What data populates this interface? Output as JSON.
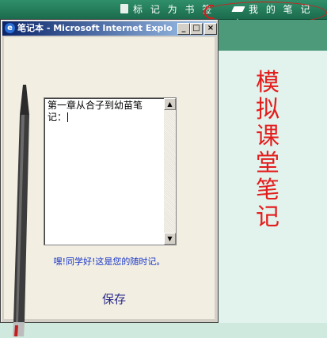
{
  "toolbar": {
    "bookmark_label": "标 记 为 书 签",
    "notebook_label": "我 的 笔 记 本"
  },
  "side": {
    "vertical_title": "模拟课堂笔记"
  },
  "window": {
    "title": "笔记本 - Microsoft Internet Explo...",
    "min_glyph": "_",
    "max_glyph": "□",
    "close_glyph": "×"
  },
  "note": {
    "text": "第一章从合子到幼苗笔记：",
    "greeting": "嘿!同学好!这是您的随时记。",
    "save_label": "保存"
  },
  "colors": {
    "toolbar_green": "#1b6b4d",
    "accent_red": "#e41d1d",
    "greeting_blue": "#1a36c8"
  }
}
